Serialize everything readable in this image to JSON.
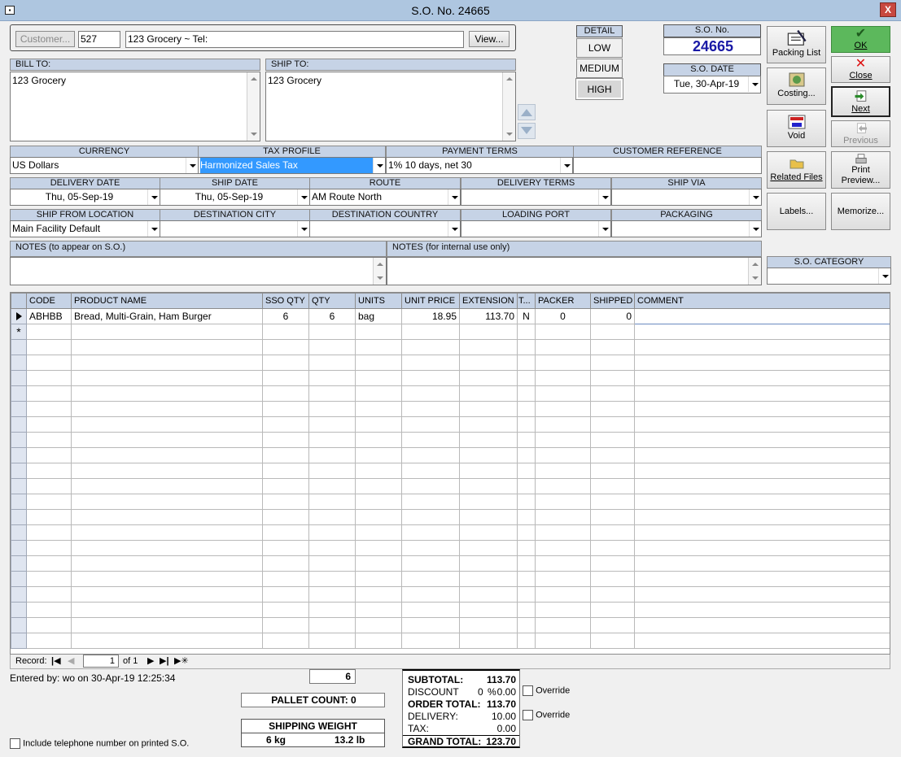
{
  "window": {
    "title": "S.O. No. 24665",
    "close_glyph": "X"
  },
  "customer": {
    "button_label": "Customer...",
    "id": "527",
    "display": "123 Grocery  ~  Tel:",
    "view_label": "View..."
  },
  "detail": {
    "header": "DETAIL",
    "low": "LOW",
    "medium": "MEDIUM",
    "high": "HIGH"
  },
  "so": {
    "no_label": "S.O. No.",
    "no": "24665",
    "date_label": "S.O. DATE",
    "date": "Tue, 30-Apr-19"
  },
  "bill_to": {
    "label": "BILL TO:",
    "text": "123 Grocery"
  },
  "ship_to": {
    "label": "SHIP TO:",
    "text": "123 Grocery"
  },
  "row1": {
    "currency": {
      "label": "CURRENCY",
      "value": "US Dollars"
    },
    "tax_profile": {
      "label": "TAX PROFILE",
      "value": "Harmonized Sales Tax"
    },
    "payment_terms": {
      "label": "PAYMENT TERMS",
      "value": "1% 10 days, net 30"
    },
    "customer_reference": {
      "label": "CUSTOMER REFERENCE",
      "value": ""
    }
  },
  "row2": {
    "delivery_date": {
      "label": "DELIVERY DATE",
      "value": "Thu, 05-Sep-19"
    },
    "ship_date": {
      "label": "SHIP DATE",
      "value": "Thu, 05-Sep-19"
    },
    "route": {
      "label": "ROUTE",
      "value": "AM Route North"
    },
    "delivery_terms": {
      "label": "DELIVERY TERMS",
      "value": ""
    },
    "ship_via": {
      "label": "SHIP VIA",
      "value": ""
    }
  },
  "row3": {
    "ship_from": {
      "label": "SHIP FROM LOCATION",
      "value": "Main Facility Default"
    },
    "destination_city": {
      "label": "DESTINATION CITY",
      "value": ""
    },
    "destination_country": {
      "label": "DESTINATION COUNTRY",
      "value": ""
    },
    "loading_port": {
      "label": "LOADING PORT",
      "value": ""
    },
    "packaging": {
      "label": "PACKAGING",
      "value": ""
    }
  },
  "notes": {
    "so_label": "NOTES (to appear on S.O.)",
    "internal_label": "NOTES (for internal use only)"
  },
  "category": {
    "label": "S.O. CATEGORY",
    "value": ""
  },
  "buttons": {
    "packing_list": "Packing List",
    "ok": "OK",
    "costing": "Costing...",
    "close": "Close",
    "void": "Void",
    "next": "Next",
    "previous": "Previous",
    "related_files": "Related Files",
    "print_preview_1": "Print",
    "print_preview_2": "Preview...",
    "labels": "Labels...",
    "memorize": "Memorize..."
  },
  "grid": {
    "columns": [
      "CODE",
      "PRODUCT NAME",
      "SSO QTY",
      "QTY",
      "UNITS",
      "UNIT PRICE",
      "EXTENSION",
      "T...",
      "PACKER",
      "SHIPPED",
      "COMMENT"
    ],
    "rows": [
      {
        "code": "ABHBB",
        "name": "Bread, Multi-Grain, Ham Burger",
        "sso_qty": "6",
        "qty": "6",
        "units": "bag",
        "unit_price": "18.95",
        "extension": "113.70",
        "tax": "N",
        "packer": "0",
        "shipped": "0",
        "comment": ""
      }
    ],
    "new_row_marker": "*"
  },
  "nav": {
    "record_label": "Record:",
    "current": "1",
    "of": "of 1"
  },
  "footer": {
    "entered_by": "Entered by: wo on 30-Apr-19 12:25:34",
    "qty_total": "6",
    "pallet_count": "PALLET COUNT: 0",
    "shipping_weight_label": "SHIPPING WEIGHT",
    "weight_kg": "6 kg",
    "weight_lb": "13.2 lb",
    "include_phone": "Include telephone number on printed S.O."
  },
  "totals": {
    "subtotal_label": "SUBTOTAL:",
    "subtotal": "113.70",
    "discount_label": "DISCOUNT",
    "discount_pct": "0",
    "discount_pct_sign": "%",
    "discount": "0.00",
    "order_total_label": "ORDER TOTAL:",
    "order_total": "113.70",
    "delivery_label": "DELIVERY:",
    "delivery": "10.00",
    "tax_label": "TAX:",
    "tax": "0.00",
    "grand_total_label": "GRAND TOTAL:",
    "grand_total": "123.70",
    "override1": "Override",
    "override2": "Override"
  },
  "colors": {
    "header_blue": "#c6d3e6",
    "title_bar": "#aec6e0",
    "ok_green": "#5cb85c",
    "selected_blue": "#3399ff",
    "so_no_blue": "#1a1aa6"
  }
}
